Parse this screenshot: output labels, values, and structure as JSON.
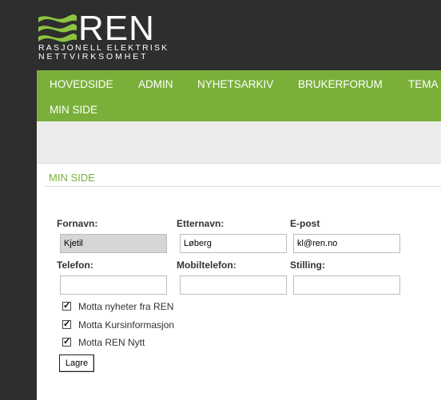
{
  "brand": {
    "name": "REN",
    "tagline_line1": "RASJONELL ELEKTRISK",
    "tagline_line2": "NETTVIRKSOMHET",
    "accent_color": "#7ab03a"
  },
  "nav": {
    "items": [
      {
        "label": "HOVEDSIDE"
      },
      {
        "label": "ADMIN"
      },
      {
        "label": "NYHETSARKIV"
      },
      {
        "label": "BRUKERFORUM"
      },
      {
        "label": "TEMA"
      },
      {
        "label": "MIN SIDE"
      }
    ]
  },
  "page": {
    "section_title": "MIN SIDE"
  },
  "form": {
    "first_name": {
      "label": "Fornavn:",
      "value": "Kjetil"
    },
    "last_name": {
      "label": "Etternavn:",
      "value": "Løberg"
    },
    "email": {
      "label": "E-post",
      "value": "kl@ren.no"
    },
    "phone": {
      "label": "Telefon:",
      "value": ""
    },
    "mobile": {
      "label": "Mobiltelefon:",
      "value": ""
    },
    "position": {
      "label": "Stilling:",
      "value": ""
    },
    "checkboxes": [
      {
        "label": "Motta nyheter fra REN",
        "checked": true
      },
      {
        "label": "Motta Kursinformasjon",
        "checked": true
      },
      {
        "label": "Motta REN Nytt",
        "checked": true
      }
    ],
    "save_label": "Lagre"
  }
}
